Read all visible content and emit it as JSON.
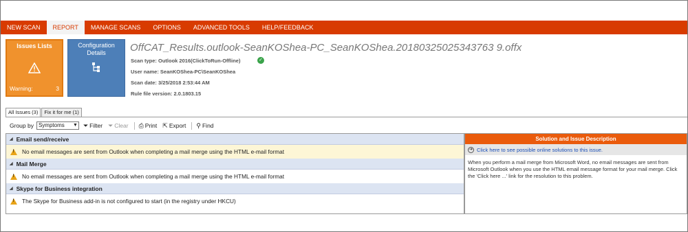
{
  "menu": {
    "items": [
      "NEW SCAN",
      "REPORT",
      "MANAGE SCANS",
      "OPTIONS",
      "ADVANCED TOOLS",
      "HELP/FEEDBACK"
    ],
    "active": "REPORT"
  },
  "tiles": {
    "issues": {
      "title": "Issues Lists",
      "warning_label": "Warning:",
      "warning_count": "3",
      "icon": "warning-triangle-icon"
    },
    "config": {
      "title": "Configuration Details",
      "icon": "tree-hierarchy-icon"
    }
  },
  "header": {
    "title": "OffCAT_Results.outlook-SeanKOShea-PC_SeanKOShea.20180325025343763 9.offx",
    "scan_type": "Scan type: Outlook 2016(ClickToRun-Offline)",
    "user_name": "User name: SeanKOShea-PC\\SeanKOShea",
    "scan_date": "Scan date: 3/25/2018 2:53:44 AM",
    "rule_version": "Rule file version: 2.0.1803.15"
  },
  "tabs": [
    "All Issues (3)",
    "Fix it for me (1)"
  ],
  "toolbar": {
    "group_by_label": "Group by",
    "group_by_value": "Symptoms",
    "filter": "Filter",
    "clear": "Clear",
    "print": "Print",
    "export": "Export",
    "find": "Find"
  },
  "issues": {
    "groups": [
      {
        "name": "Email send/receive",
        "items": [
          "No email messages are sent from Outlook when completing a mail merge using the HTML e-mail format"
        ]
      },
      {
        "name": "Mail Merge",
        "items": [
          "No email messages are sent from Outlook when completing a mail merge using the HTML e-mail format"
        ]
      },
      {
        "name": "Skype for Business integration",
        "items": [
          "The Skype for Business add-in is not configured to start (in the registry under HKCU)"
        ]
      }
    ]
  },
  "solution": {
    "heading": "Solution and Issue Description",
    "link": "Click here to see possible online solutions to this issue.",
    "text": "When you perform a mail merge from Microsoft Word, no email messages are sent from Microsoft Outlook when you use the HTML email message format for your mail merge. Click the 'Click here ...' link for the resolution to this problem."
  }
}
